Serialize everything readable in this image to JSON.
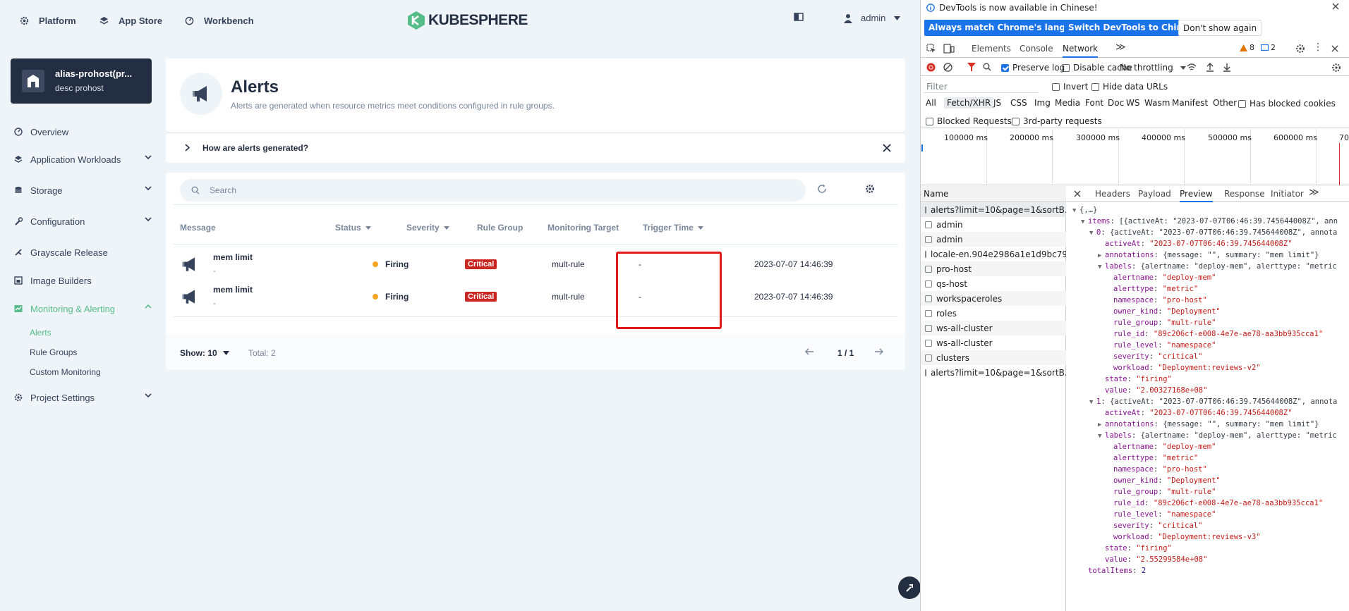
{
  "topnav": {
    "platform": "Platform",
    "app_store": "App Store",
    "workbench": "Workbench",
    "logo": "KUBESPHERE",
    "user": "admin"
  },
  "workspace": {
    "title": "alias-prohost(pr...",
    "desc": "desc prohost"
  },
  "sidebar": {
    "items": [
      {
        "label": "Overview"
      },
      {
        "label": "Application Workloads"
      },
      {
        "label": "Storage"
      },
      {
        "label": "Configuration"
      },
      {
        "label": "Grayscale Release"
      },
      {
        "label": "Image Builders"
      },
      {
        "label": "Monitoring & Alerting"
      },
      {
        "label": "Project Settings"
      }
    ],
    "subitems": [
      {
        "label": "Alerts"
      },
      {
        "label": "Rule Groups"
      },
      {
        "label": "Custom Monitoring"
      }
    ]
  },
  "header": {
    "title": "Alerts",
    "desc": "Alerts are generated when resource metrics meet conditions configured in rule groups.",
    "how": "How are alerts generated?"
  },
  "search": {
    "placeholder": "Search"
  },
  "table": {
    "columns": [
      "Message",
      "Status",
      "Severity",
      "Rule Group",
      "Monitoring Target",
      "Trigger Time"
    ],
    "rows": [
      {
        "message": "mem limit",
        "sub": "-",
        "status": "Firing",
        "severity": "Critical",
        "rule_group": "mult-rule",
        "target": "-",
        "time": "2023-07-07 14:46:39"
      },
      {
        "message": "mem limit",
        "sub": "-",
        "status": "Firing",
        "severity": "Critical",
        "rule_group": "mult-rule",
        "target": "-",
        "time": "2023-07-07 14:46:39"
      }
    ],
    "show": "Show: 10",
    "total": "Total: 2",
    "page": "1 / 1"
  },
  "devtools": {
    "info": "DevTools is now available in Chinese!",
    "btn_match": "Always match Chrome's language",
    "btn_switch": "Switch DevTools to Chinese",
    "btn_dont": "Don't show again",
    "tabs": [
      "Elements",
      "Console",
      "Network"
    ],
    "warn_count": "8",
    "msg_count": "2",
    "preserve_log": "Preserve log",
    "disable_cache": "Disable cache",
    "throttling": "No throttling",
    "filter_placeholder": "Filter",
    "invert": "Invert",
    "hide_data": "Hide data URLs",
    "types": [
      "All",
      "Fetch/XHR",
      "JS",
      "CSS",
      "Img",
      "Media",
      "Font",
      "Doc",
      "WS",
      "Wasm",
      "Manifest",
      "Other"
    ],
    "has_blocked": "Has blocked cookies",
    "blocked_requests": "Blocked Requests",
    "third_party": "3rd-party requests",
    "timeline": [
      "100000 ms",
      "200000 ms",
      "300000 ms",
      "400000 ms",
      "500000 ms",
      "600000 ms",
      "70"
    ],
    "name_header": "Name",
    "requests": [
      "alerts?limit=10&page=1&sortB...",
      "admin",
      "admin",
      "locale-en.904e2986a1e1d9bc79...",
      "pro-host",
      "qs-host",
      "workspaceroles",
      "roles",
      "ws-all-cluster",
      "ws-all-cluster",
      "clusters",
      "alerts?limit=10&page=1&sortB..."
    ],
    "preview_tabs": [
      "Headers",
      "Payload",
      "Preview",
      "Response",
      "Initiator"
    ],
    "json": {
      "root": "{,…}",
      "items_line": "[{activeAt: \"2023-07-07T06:46:39.745644008Z\", ann",
      "item0_line": "{activeAt: \"2023-07-07T06:46:39.745644008Z\", annota",
      "item1_line": "{activeAt: \"2023-07-07T06:46:39.745644008Z\", annota",
      "activeAt": "\"2023-07-07T06:46:39.745644008Z\"",
      "annotations": "{message: \"\", summary: \"mem limit\"}",
      "labels": "{alertname: \"deploy-mem\", alerttype: \"metric",
      "alertname": "\"deploy-mem\"",
      "alerttype": "\"metric\"",
      "namespace": "\"pro-host\"",
      "owner_kind": "\"Deployment\"",
      "rule_group": "\"mult-rule\"",
      "rule_id": "\"89c206cf-e008-4e7e-ae78-aa3bb935cca1\"",
      "rule_level": "\"namespace\"",
      "severity": "\"critical\"",
      "workload0": "\"Deployment:reviews-v2\"",
      "workload1": "\"Deployment:reviews-v3\"",
      "state": "\"firing\"",
      "value0": "\"2.00327168e+08\"",
      "value1": "\"2.55299584e+08\"",
      "totalItems": "2"
    }
  }
}
